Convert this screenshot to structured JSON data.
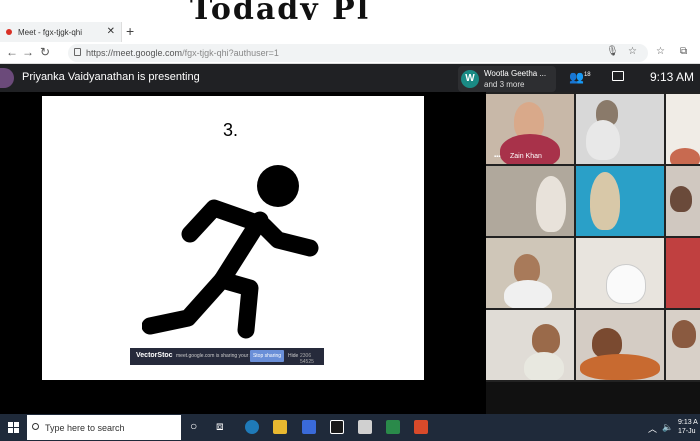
{
  "handwriting_text": "Todady Pl",
  "browser": {
    "tab_title": "Meet - fgx-tjgk-qhi",
    "url_host": "https://meet.google.com",
    "url_path": "/fgx-tjgk-qhi?authuser=1"
  },
  "meet": {
    "presenter_text": "Priyanka Vaidyanathan is presenting",
    "notification": {
      "initial": "W",
      "line1": "Wootla Geetha ...",
      "line2": "and 3 more"
    },
    "participant_count": "18",
    "time": "9:13 AM"
  },
  "slide": {
    "number": "3.",
    "share_bar": {
      "brand": "VectorStoc",
      "message": "meet.google.com is sharing your screen.",
      "stop_label": "Stop sharing",
      "hide_label": "Hide",
      "image_id": "2306 54525"
    }
  },
  "participants": {
    "featured_name": "Zain Khan"
  },
  "taskbar": {
    "search_placeholder": "Type here to search",
    "clock_time": "9:13 A",
    "clock_date": "17-Ju"
  },
  "colors": {
    "meet_bg": "#202124",
    "notification_avatar": "#1a8a84",
    "taskbar_bg": "#1f2a3a",
    "record_dot": "#d93025"
  }
}
